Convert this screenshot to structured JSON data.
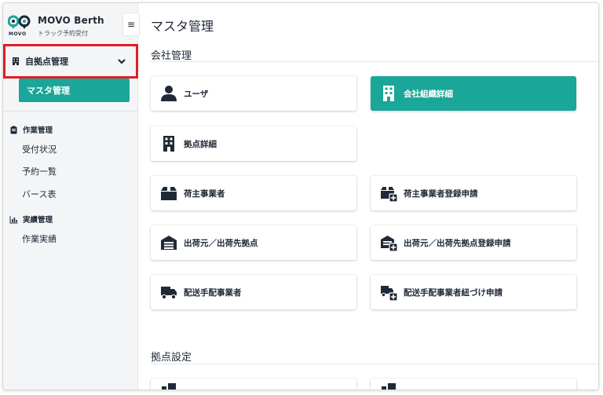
{
  "brand": {
    "name": "MOVO Berth",
    "subtitle": "トラック予約受付",
    "logo_text": "MOVO"
  },
  "sidebar": {
    "collapse_icon": "hamburger-icon",
    "dropdown": {
      "label": "自拠点管理",
      "icon": "building-icon",
      "chevron": "chevron-down-icon"
    },
    "active_item": "マスタ管理",
    "groups": [
      {
        "label": "作業管理",
        "icon": "clipboard-icon",
        "items": [
          "受付状況",
          "予約一覧",
          "バース表"
        ]
      },
      {
        "label": "実績管理",
        "icon": "bar-chart-icon",
        "items": [
          "作業実績"
        ]
      }
    ]
  },
  "main": {
    "title": "マスタ管理",
    "sections": [
      {
        "title": "会社管理",
        "cards": [
          {
            "label": "ユーザ",
            "icon": "user-icon"
          },
          {
            "label": "会社組織詳細",
            "icon": "building-icon",
            "active": true
          },
          {
            "label": "拠点詳細",
            "icon": "building-icon"
          },
          {
            "label": "荷主事業者",
            "icon": "box-icon"
          },
          {
            "label": "荷主事業者登録申請",
            "icon": "box-plus-icon"
          },
          {
            "label": "出荷元／出荷先拠点",
            "icon": "warehouse-icon"
          },
          {
            "label": "出荷元／出荷先拠点登録申請",
            "icon": "warehouse-plus-icon"
          },
          {
            "label": "配送手配事業者",
            "icon": "truck-icon"
          },
          {
            "label": "配送手配事業者紐づけ申請",
            "icon": "truck-plus-icon"
          }
        ]
      },
      {
        "title": "拠点設定",
        "cards": []
      }
    ]
  },
  "colors": {
    "accent": "#1aa698",
    "highlight_border": "#e11d23",
    "sidebar_bg": "#f4f5f7"
  }
}
